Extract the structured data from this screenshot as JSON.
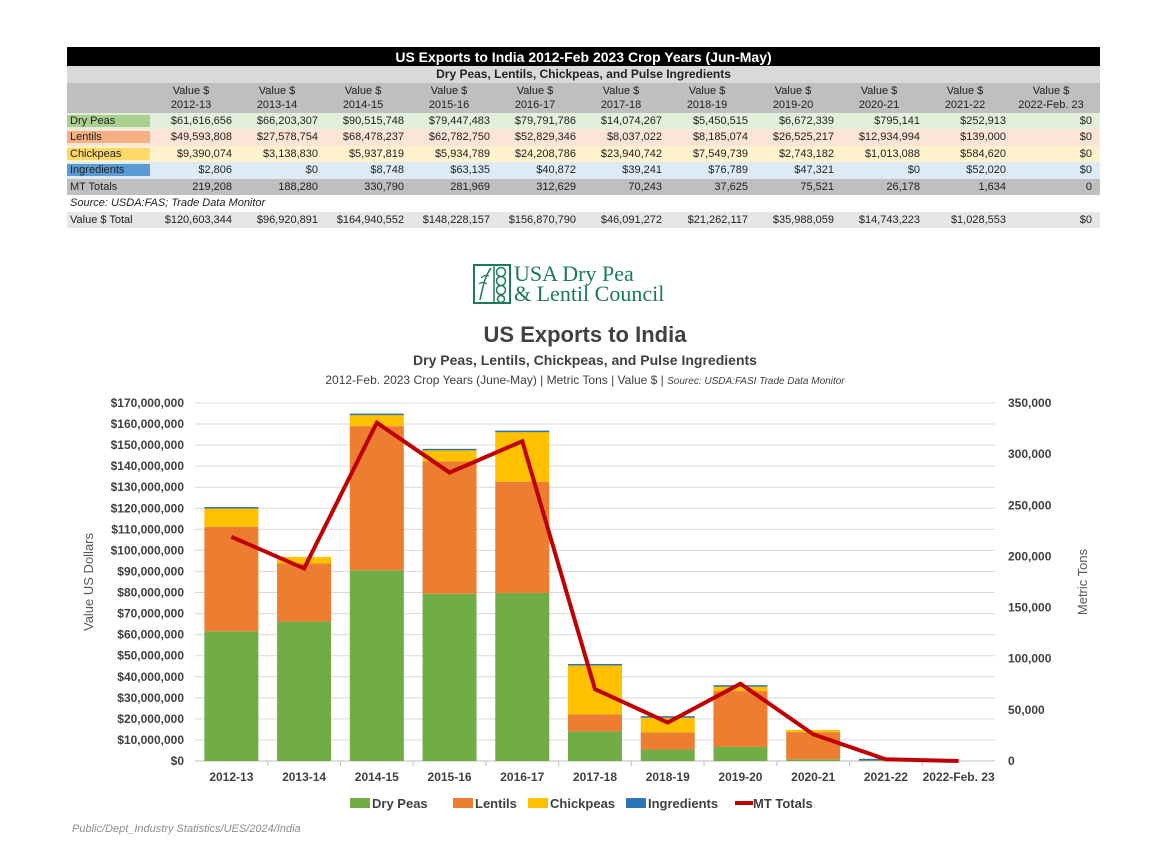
{
  "table": {
    "title": "US Exports to India  2012-Feb 2023 Crop Years (Jun-May)",
    "subtitle": "Dry Peas, Lentils, Chickpeas, and Pulse Ingredients",
    "header_top": "Value $",
    "years": [
      "2012-13",
      "2013-14",
      "2014-15",
      "2015-16",
      "2016-17",
      "2017-18",
      "2018-19",
      "2019-20",
      "2020-21",
      "2021-22",
      "2022-Feb. 23"
    ],
    "rows": [
      {
        "label": "Dry Peas",
        "values": [
          "$61,616,656",
          "$66,203,307",
          "$90,515,748",
          "$79,447,483",
          "$79,791,786",
          "$14,074,267",
          "$5,450,515",
          "$6,672,339",
          "$795,141",
          "$252,913",
          "$0"
        ]
      },
      {
        "label": "Lentils",
        "values": [
          "$49,593,808",
          "$27,578,754",
          "$68,478,237",
          "$62,782,750",
          "$52,829,346",
          "$8,037,022",
          "$8,185,074",
          "$26,525,217",
          "$12,934,994",
          "$139,000",
          "$0"
        ]
      },
      {
        "label": "Chickpeas",
        "values": [
          "$9,390,074",
          "$3,138,830",
          "$5,937,819",
          "$5,934,789",
          "$24,208,786",
          "$23,940,742",
          "$7,549,739",
          "$2,743,182",
          "$1,013,088",
          "$584,620",
          "$0"
        ]
      },
      {
        "label": "Ingredients",
        "values": [
          "$2,806",
          "$0",
          "$8,748",
          "$63,135",
          "$40,872",
          "$39,241",
          "$76,789",
          "$47,321",
          "$0",
          "$52,020",
          "$0"
        ]
      },
      {
        "label": "MT Totals",
        "values": [
          "219,208",
          "188,280",
          "330,790",
          "281,969",
          "312,629",
          "70,243",
          "37,625",
          "75,521",
          "26,178",
          "1,634",
          "0"
        ]
      }
    ],
    "source": "Source: USDA:FAS; Trade Data Monitor",
    "total_row": {
      "label": "Value $ Total",
      "values": [
        "$120,603,344",
        "$96,920,891",
        "$164,940,552",
        "$148,228,157",
        "$156,870,790",
        "$46,091,272",
        "$21,262,117",
        "$35,988,059",
        "$14,743,223",
        "$1,028,553",
        "$0"
      ]
    }
  },
  "logo": {
    "line1": "USA Dry Pea",
    "line2": "& Lentil Council"
  },
  "footer": "Public/Dept_Industry Statistics/UES/2024/India",
  "chart_data": {
    "type": "bar",
    "stacked": true,
    "title": "US Exports to India",
    "subtitle": "Dry Peas, Lentils, Chickpeas, and Pulse Ingredients",
    "caption_main": "2012-Feb.  2023 Crop Years (June-May)   |   Metric Tons   | Value $   |",
    "caption_source": "Sourec: USDA:FASI Trade Data Monitor",
    "categories": [
      "2012-13",
      "2013-14",
      "2014-15",
      "2015-16",
      "2016-17",
      "2017-18",
      "2018-19",
      "2019-20",
      "2020-21",
      "2021-22",
      "2022-Feb. 23"
    ],
    "ylabel": "Value US Dollars",
    "y2label": "Metric Tons",
    "ylim": [
      0,
      170000000
    ],
    "y_ticks": [
      "$0",
      "$10,000,000",
      "$20,000,000",
      "$30,000,000",
      "$40,000,000",
      "$50,000,000",
      "$60,000,000",
      "$70,000,000",
      "$80,000,000",
      "$90,000,000",
      "$100,000,000",
      "$110,000,000",
      "$120,000,000",
      "$130,000,000",
      "$140,000,000",
      "$150,000,000",
      "$160,000,000",
      "$170,000,000"
    ],
    "y2lim": [
      0,
      350000
    ],
    "y2_ticks": [
      "0",
      "50,000",
      "100,000",
      "150,000",
      "200,000",
      "250,000",
      "300,000",
      "350,000"
    ],
    "grid": true,
    "legend": "bottom",
    "series": [
      {
        "name": "Dry Peas",
        "color": "#70ad47",
        "values": [
          61616656,
          66203307,
          90515748,
          79447483,
          79791786,
          14074267,
          5450515,
          6672339,
          795141,
          252913,
          0
        ]
      },
      {
        "name": "Lentils",
        "color": "#ed7d31",
        "values": [
          49593808,
          27578754,
          68478237,
          62782750,
          52829346,
          8037022,
          8185074,
          26525217,
          12934994,
          139000,
          0
        ]
      },
      {
        "name": "Chickpeas",
        "color": "#ffc000",
        "values": [
          9390074,
          3138830,
          5937819,
          5934789,
          24208786,
          23940742,
          7549739,
          2743182,
          1013088,
          584620,
          0
        ]
      },
      {
        "name": "Ingredients",
        "color": "#2e75b6",
        "values": [
          2806,
          0,
          8748,
          63135,
          40872,
          39241,
          76789,
          47321,
          0,
          52020,
          0
        ]
      }
    ],
    "line_series": {
      "name": "MT Totals",
      "color": "#c00000",
      "axis": "secondary",
      "values": [
        219208,
        188280,
        330790,
        281969,
        312629,
        70243,
        37625,
        75521,
        26178,
        1634,
        0
      ]
    }
  }
}
